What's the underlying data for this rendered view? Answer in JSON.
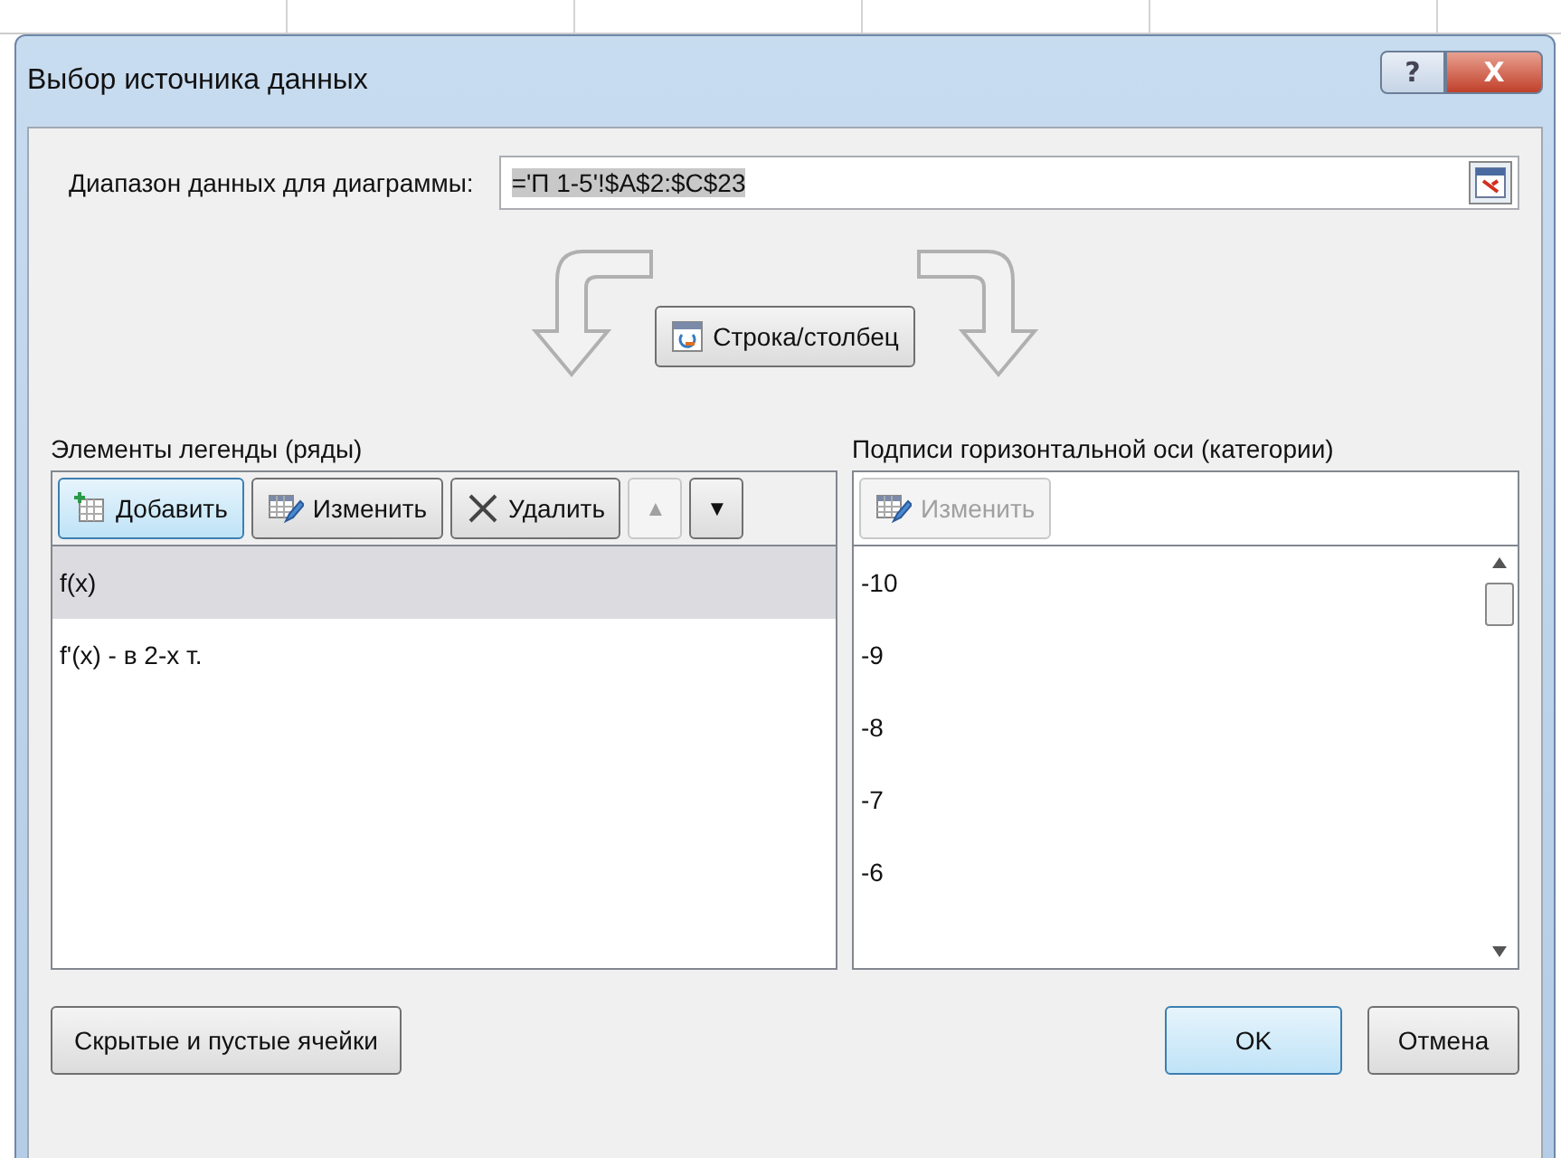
{
  "window": {
    "title": "Выбор источника данных",
    "help": "?",
    "close": "X"
  },
  "range": {
    "label": "Диапазон данных для диаграммы:",
    "value": "='П 1-5'!$A$2:$C$23"
  },
  "switch_button": "Строка/столбец",
  "legend": {
    "title": "Элементы легенды (ряды)",
    "buttons": [
      {
        "label": "Добавить",
        "kind": "add",
        "focused": true,
        "disabled": false
      },
      {
        "label": "Изменить",
        "kind": "edit",
        "focused": false,
        "disabled": false
      },
      {
        "label": "Удалить",
        "kind": "delete",
        "focused": false,
        "disabled": false
      },
      {
        "label": "▲",
        "kind": "up",
        "focused": false,
        "disabled": true
      },
      {
        "label": "▼",
        "kind": "down",
        "focused": false,
        "disabled": false
      }
    ],
    "items": [
      {
        "label": "f(x)",
        "selected": true
      },
      {
        "label": "f'(x) - в 2-х т.",
        "selected": false
      }
    ]
  },
  "categories": {
    "title": "Подписи горизонтальной оси (категории)",
    "buttons": [
      {
        "label": "Изменить",
        "kind": "edit",
        "disabled": true
      }
    ],
    "items": [
      {
        "label": "-10"
      },
      {
        "label": "-9"
      },
      {
        "label": "-8"
      },
      {
        "label": "-7"
      },
      {
        "label": "-6"
      }
    ]
  },
  "footer": {
    "hidden_cells": "Скрытые и пустые ячейки",
    "ok": "OK",
    "cancel": "Отмена"
  }
}
